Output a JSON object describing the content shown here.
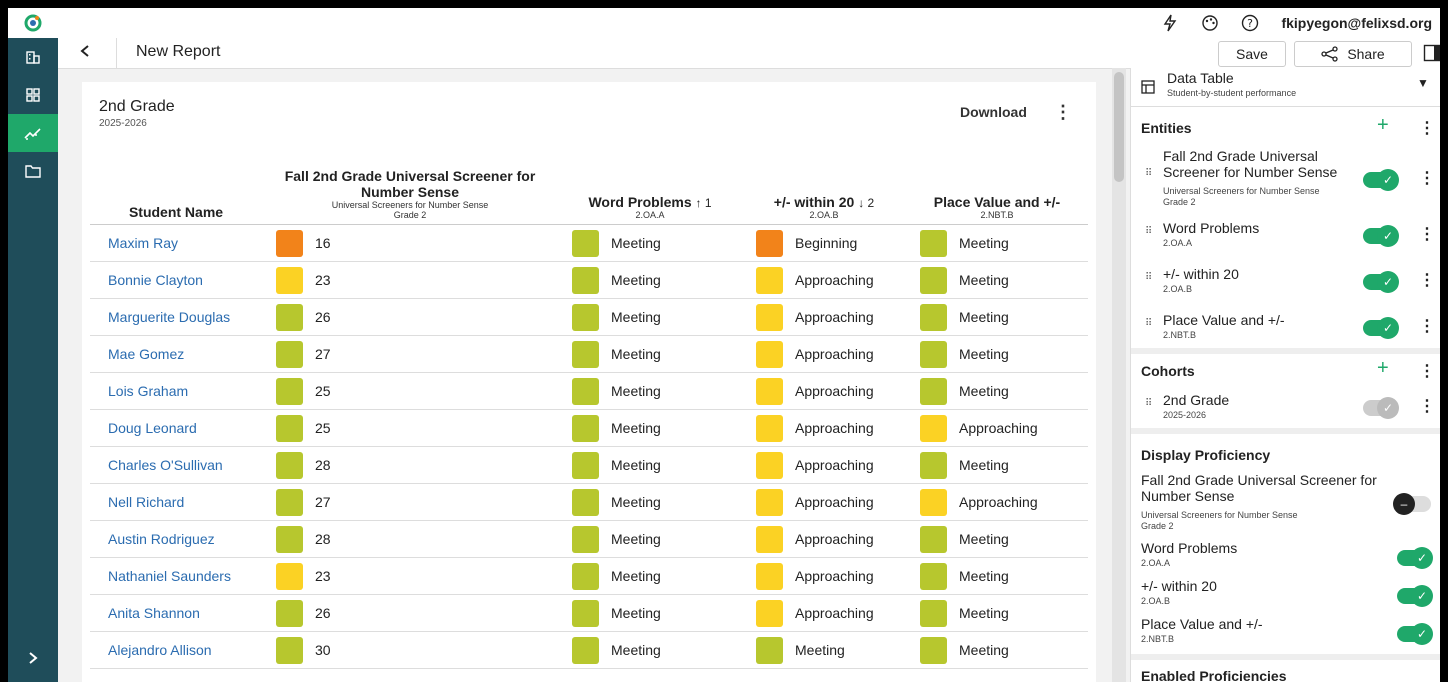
{
  "colors": {
    "sidebar": "#1f4d5a",
    "accent": "#1fa86a",
    "meeting": "#b7c72e",
    "approaching": "#fbd224",
    "beginning": "#f2831a",
    "link": "#2b6cb0"
  },
  "topbar": {
    "email": "fkipyegon@felixsd.org",
    "icons": [
      "bolt-icon",
      "palette-icon",
      "help-icon"
    ]
  },
  "sidebar": {
    "items": [
      "organization-icon",
      "dashboard-icon",
      "analytics-icon",
      "folder-icon"
    ],
    "active": 2
  },
  "header": {
    "back_label": "<",
    "title": "New Report",
    "save_label": "Save",
    "share_label": "Share"
  },
  "report": {
    "grade": "2nd Grade",
    "year": "2025-2026",
    "download_label": "Download",
    "columns": [
      {
        "title": "Student Name",
        "sub1": "",
        "sub2": ""
      },
      {
        "title": "Fall 2nd Grade Universal Screener for Number Sense",
        "sub1": "Universal Screeners for Number Sense",
        "sub2": "Grade 2"
      },
      {
        "title": "Word Problems",
        "sort": "↑ 1",
        "sub1": "2.OA.A"
      },
      {
        "title": "+/- within 20",
        "sort": "↓ 2",
        "sub1": "2.OA.B"
      },
      {
        "title": "Place Value and +/-",
        "sub1": "2.NBT.B"
      }
    ],
    "rows": [
      {
        "name": "Maxim Ray",
        "score": "16",
        "score_color": "orange",
        "wp": "Meeting",
        "wp_color": "green",
        "w20": "Beginning",
        "w20_color": "orange",
        "pv": "Meeting",
        "pv_color": "green"
      },
      {
        "name": "Bonnie Clayton",
        "score": "23",
        "score_color": "yellow",
        "wp": "Meeting",
        "wp_color": "green",
        "w20": "Approaching",
        "w20_color": "yellow",
        "pv": "Meeting",
        "pv_color": "green"
      },
      {
        "name": "Marguerite Douglas",
        "score": "26",
        "score_color": "green",
        "wp": "Meeting",
        "wp_color": "green",
        "w20": "Approaching",
        "w20_color": "yellow",
        "pv": "Meeting",
        "pv_color": "green"
      },
      {
        "name": "Mae Gomez",
        "score": "27",
        "score_color": "green",
        "wp": "Meeting",
        "wp_color": "green",
        "w20": "Approaching",
        "w20_color": "yellow",
        "pv": "Meeting",
        "pv_color": "green"
      },
      {
        "name": "Lois Graham",
        "score": "25",
        "score_color": "green",
        "wp": "Meeting",
        "wp_color": "green",
        "w20": "Approaching",
        "w20_color": "yellow",
        "pv": "Meeting",
        "pv_color": "green"
      },
      {
        "name": "Doug Leonard",
        "score": "25",
        "score_color": "green",
        "wp": "Meeting",
        "wp_color": "green",
        "w20": "Approaching",
        "w20_color": "yellow",
        "pv": "Approaching",
        "pv_color": "yellow"
      },
      {
        "name": "Charles O'Sullivan",
        "score": "28",
        "score_color": "green",
        "wp": "Meeting",
        "wp_color": "green",
        "w20": "Approaching",
        "w20_color": "yellow",
        "pv": "Meeting",
        "pv_color": "green"
      },
      {
        "name": "Nell Richard",
        "score": "27",
        "score_color": "green",
        "wp": "Meeting",
        "wp_color": "green",
        "w20": "Approaching",
        "w20_color": "yellow",
        "pv": "Approaching",
        "pv_color": "yellow"
      },
      {
        "name": "Austin Rodriguez",
        "score": "28",
        "score_color": "green",
        "wp": "Meeting",
        "wp_color": "green",
        "w20": "Approaching",
        "w20_color": "yellow",
        "pv": "Meeting",
        "pv_color": "green"
      },
      {
        "name": "Nathaniel Saunders",
        "score": "23",
        "score_color": "yellow",
        "wp": "Meeting",
        "wp_color": "green",
        "w20": "Approaching",
        "w20_color": "yellow",
        "pv": "Meeting",
        "pv_color": "green"
      },
      {
        "name": "Anita Shannon",
        "score": "26",
        "score_color": "green",
        "wp": "Meeting",
        "wp_color": "green",
        "w20": "Approaching",
        "w20_color": "yellow",
        "pv": "Meeting",
        "pv_color": "green"
      },
      {
        "name": "Alejandro Allison",
        "score": "30",
        "score_color": "green",
        "wp": "Meeting",
        "wp_color": "green",
        "w20": "Meeting",
        "w20_color": "green",
        "pv": "Meeting",
        "pv_color": "green"
      }
    ]
  },
  "panel": {
    "data_table": {
      "title": "Data Table",
      "subtitle": "Student-by-student performance"
    },
    "entities_title": "Entities",
    "entities": [
      {
        "title": "Fall 2nd Grade Universal Screener for Number Sense",
        "sub1": "Universal Screeners for Number Sense",
        "sub2": "Grade 2",
        "on": true
      },
      {
        "title": "Word Problems",
        "sub1": "2.OA.A",
        "sub2": "",
        "on": true
      },
      {
        "title": "+/- within 20",
        "sub1": "2.OA.B",
        "sub2": "",
        "on": true
      },
      {
        "title": "Place Value and +/-",
        "sub1": "2.NBT.B",
        "sub2": "",
        "on": true
      }
    ],
    "cohorts_title": "Cohorts",
    "cohort": {
      "title": "2nd Grade",
      "sub": "2025-2026"
    },
    "display_title": "Display Proficiency",
    "display": [
      {
        "title": "Fall 2nd Grade Universal Screener for Number Sense",
        "sub1": "Universal Screeners for Number Sense",
        "sub2": "Grade 2",
        "on": false
      },
      {
        "title": "Word Problems",
        "sub1": "2.OA.A",
        "on": true
      },
      {
        "title": "+/- within 20",
        "sub1": "2.OA.B",
        "on": true
      },
      {
        "title": "Place Value and +/-",
        "sub1": "2.NBT.B",
        "on": true
      }
    ],
    "enabled_title": "Enabled Proficiencies"
  }
}
